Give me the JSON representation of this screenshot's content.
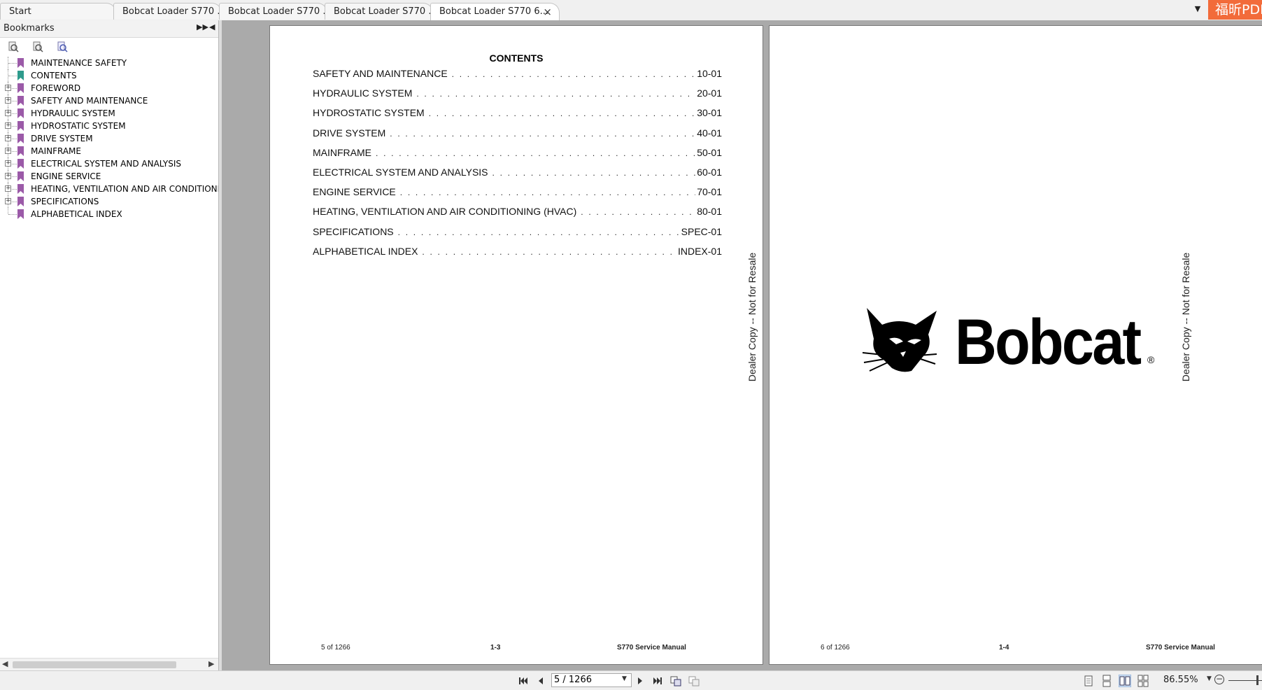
{
  "tabs": [
    {
      "label": "Start",
      "active": false
    },
    {
      "label": "Bobcat Loader S770 ...",
      "active": false
    },
    {
      "label": "Bobcat Loader S770 ...",
      "active": false
    },
    {
      "label": "Bobcat Loader S770 ...",
      "active": false
    },
    {
      "label": "Bobcat Loader S770 6...",
      "active": true
    }
  ],
  "brand_badge": "福昕PDF",
  "bookmarks": {
    "title": "Bookmarks",
    "items": [
      {
        "label": "MAINTENANCE SAFETY",
        "expandable": false,
        "color": "#9b5aa8"
      },
      {
        "label": "CONTENTS",
        "expandable": false,
        "color": "#2e9b8c"
      },
      {
        "label": "FOREWORD",
        "expandable": true,
        "color": "#9b5aa8"
      },
      {
        "label": "SAFETY AND MAINTENANCE",
        "expandable": true,
        "color": "#9b5aa8"
      },
      {
        "label": "HYDRAULIC SYSTEM",
        "expandable": true,
        "color": "#9b5aa8"
      },
      {
        "label": "HYDROSTATIC SYSTEM",
        "expandable": true,
        "color": "#9b5aa8"
      },
      {
        "label": "DRIVE SYSTEM",
        "expandable": true,
        "color": "#9b5aa8"
      },
      {
        "label": "MAINFRAME",
        "expandable": true,
        "color": "#9b5aa8"
      },
      {
        "label": "ELECTRICAL SYSTEM AND ANALYSIS",
        "expandable": true,
        "color": "#9b5aa8"
      },
      {
        "label": "ENGINE SERVICE",
        "expandable": true,
        "color": "#9b5aa8"
      },
      {
        "label": "HEATING, VENTILATION AND AIR CONDITIONIN",
        "expandable": true,
        "color": "#9b5aa8"
      },
      {
        "label": "SPECIFICATIONS",
        "expandable": true,
        "color": "#9b5aa8"
      },
      {
        "label": "ALPHABETICAL INDEX",
        "expandable": false,
        "color": "#9b5aa8"
      }
    ]
  },
  "page_left": {
    "contents_title": "CONTENTS",
    "toc": [
      {
        "title": "SAFETY AND MAINTENANCE",
        "page": "10-01"
      },
      {
        "title": "HYDRAULIC SYSTEM",
        "page": "20-01"
      },
      {
        "title": "HYDROSTATIC SYSTEM",
        "page": "30-01"
      },
      {
        "title": "DRIVE SYSTEM",
        "page": "40-01"
      },
      {
        "title": "MAINFRAME",
        "page": "50-01"
      },
      {
        "title": "ELECTRICAL SYSTEM AND ANALYSIS",
        "page": "60-01"
      },
      {
        "title": "ENGINE SERVICE",
        "page": "70-01"
      },
      {
        "title": "HEATING, VENTILATION AND AIR CONDITIONING (HVAC)",
        "page": "80-01"
      },
      {
        "title": "SPECIFICATIONS",
        "page": "SPEC-01"
      },
      {
        "title": "ALPHABETICAL INDEX",
        "page": "INDEX-01"
      }
    ],
    "watermark": "Dealer Copy -- Not for Resale",
    "footer_left": "5 of 1266",
    "footer_center": "1-3",
    "footer_right": "S770 Service Manual"
  },
  "page_right": {
    "logo_text": "Bobcat",
    "logo_reg": "®",
    "watermark": "Dealer Copy -- Not for Resale",
    "footer_left": "6 of 1266",
    "footer_center": "1-4",
    "footer_right": "S770 Service Manual"
  },
  "statusbar": {
    "page_value": "5 / 1266",
    "zoom": "86.55%"
  }
}
